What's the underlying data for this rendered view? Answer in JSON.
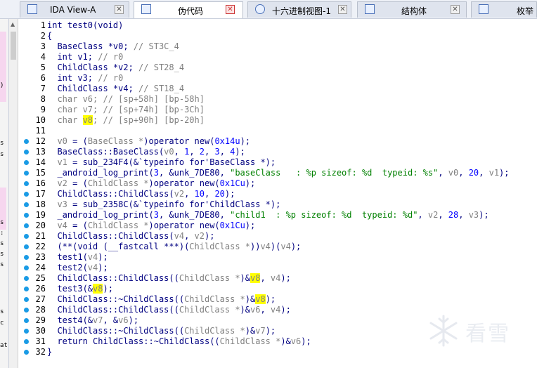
{
  "tabs": [
    {
      "label": "IDA View-A",
      "icon": "ida-view-icon",
      "active": false
    },
    {
      "label": "伪代码",
      "icon": "pseudocode-icon",
      "active": true
    },
    {
      "label": "十六进制视图-1",
      "icon": "hex-view-icon",
      "active": false
    },
    {
      "label": "结构体",
      "icon": "structures-icon",
      "active": false
    },
    {
      "label": "枚举",
      "icon": "enums-icon",
      "active": false
    }
  ],
  "left_fragments": [
    ")",
    "s",
    "s",
    "s",
    ":",
    "s",
    "s",
    "s",
    "s",
    "c",
    "at"
  ],
  "watermark": {
    "text": "看雪"
  },
  "colors": {
    "highlight": "#ffff00",
    "keyword": "#000080",
    "comment": "#808080",
    "string": "#008000",
    "number": "#0000ff",
    "breakpoint_dot": "#1a9be5"
  },
  "lines": [
    {
      "n": "1",
      "dot": false,
      "segs": [
        [
          "t",
          "int test0(void)"
        ]
      ]
    },
    {
      "n": "2",
      "dot": false,
      "segs": [
        [
          "t",
          "{"
        ]
      ]
    },
    {
      "n": "3",
      "dot": false,
      "segs": [
        [
          "t",
          "  BaseClass *v0; "
        ],
        [
          "c",
          "// ST3C_4"
        ]
      ]
    },
    {
      "n": "4",
      "dot": false,
      "segs": [
        [
          "t",
          "  int v1; "
        ],
        [
          "c",
          "// r0"
        ]
      ]
    },
    {
      "n": "5",
      "dot": false,
      "segs": [
        [
          "t",
          "  ChildClass *v2; "
        ],
        [
          "c",
          "// ST28_4"
        ]
      ]
    },
    {
      "n": "6",
      "dot": false,
      "segs": [
        [
          "t",
          "  int v3; "
        ],
        [
          "c",
          "// r0"
        ]
      ]
    },
    {
      "n": "7",
      "dot": false,
      "segs": [
        [
          "t",
          "  ChildClass *v4; "
        ],
        [
          "c",
          "// ST18_4"
        ]
      ]
    },
    {
      "n": "8",
      "dot": false,
      "segs": [
        [
          "c",
          "  char v6; // [sp+58h] [bp-58h]"
        ]
      ]
    },
    {
      "n": "9",
      "dot": false,
      "segs": [
        [
          "c",
          "  char v7; // [sp+74h] [bp-3Ch]"
        ]
      ]
    },
    {
      "n": "10",
      "dot": false,
      "segs": [
        [
          "c",
          "  char "
        ],
        [
          "ch",
          "v8"
        ],
        [
          "c",
          "; // [sp+90h] [bp-20h]"
        ]
      ]
    },
    {
      "n": "11",
      "dot": false,
      "segs": [
        [
          "t",
          ""
        ]
      ]
    },
    {
      "n": "12",
      "dot": true,
      "segs": [
        [
          "t",
          "  "
        ],
        [
          "g",
          "v0"
        ],
        [
          "t",
          " = ("
        ],
        [
          "g",
          "BaseClass *"
        ],
        [
          "t",
          ")operator new("
        ],
        [
          "n",
          "0x14u"
        ],
        [
          "t",
          ");"
        ]
      ]
    },
    {
      "n": "13",
      "dot": true,
      "segs": [
        [
          "t",
          "  BaseClass::BaseClass("
        ],
        [
          "g",
          "v0"
        ],
        [
          "t",
          ", "
        ],
        [
          "n",
          "1"
        ],
        [
          "t",
          ", "
        ],
        [
          "n",
          "2"
        ],
        [
          "t",
          ", "
        ],
        [
          "n",
          "3"
        ],
        [
          "t",
          ", "
        ],
        [
          "n",
          "4"
        ],
        [
          "t",
          ");"
        ]
      ]
    },
    {
      "n": "14",
      "dot": true,
      "segs": [
        [
          "t",
          "  "
        ],
        [
          "g",
          "v1"
        ],
        [
          "t",
          " = sub_234F4(&`typeinfo for'BaseClass *);"
        ]
      ]
    },
    {
      "n": "15",
      "dot": true,
      "segs": [
        [
          "t",
          "  _android_log_print("
        ],
        [
          "n",
          "3"
        ],
        [
          "t",
          ", &unk_7DE80, "
        ],
        [
          "s",
          "\"baseClass   : %p sizeof: %d  typeid: %s\""
        ],
        [
          "t",
          ", "
        ],
        [
          "g",
          "v0"
        ],
        [
          "t",
          ", "
        ],
        [
          "n",
          "20"
        ],
        [
          "t",
          ", "
        ],
        [
          "g",
          "v1"
        ],
        [
          "t",
          ");"
        ]
      ]
    },
    {
      "n": "16",
      "dot": true,
      "segs": [
        [
          "t",
          "  "
        ],
        [
          "g",
          "v2"
        ],
        [
          "t",
          " = ("
        ],
        [
          "g",
          "ChildClass *"
        ],
        [
          "t",
          ")operator new("
        ],
        [
          "n",
          "0x1Cu"
        ],
        [
          "t",
          ");"
        ]
      ]
    },
    {
      "n": "17",
      "dot": true,
      "segs": [
        [
          "t",
          "  ChildClass::ChildClass("
        ],
        [
          "g",
          "v2"
        ],
        [
          "t",
          ", "
        ],
        [
          "n",
          "10"
        ],
        [
          "t",
          ", "
        ],
        [
          "n",
          "20"
        ],
        [
          "t",
          ");"
        ]
      ]
    },
    {
      "n": "18",
      "dot": true,
      "segs": [
        [
          "t",
          "  "
        ],
        [
          "g",
          "v3"
        ],
        [
          "t",
          " = sub_2358C(&`typeinfo for'ChildClass *);"
        ]
      ]
    },
    {
      "n": "19",
      "dot": true,
      "segs": [
        [
          "t",
          "  _android_log_print("
        ],
        [
          "n",
          "3"
        ],
        [
          "t",
          ", &unk_7DE80, "
        ],
        [
          "s",
          "\"child1  : %p sizeof: %d  typeid: %d\""
        ],
        [
          "t",
          ", "
        ],
        [
          "g",
          "v2"
        ],
        [
          "t",
          ", "
        ],
        [
          "n",
          "28"
        ],
        [
          "t",
          ", "
        ],
        [
          "g",
          "v3"
        ],
        [
          "t",
          ");"
        ]
      ]
    },
    {
      "n": "20",
      "dot": true,
      "segs": [
        [
          "t",
          "  "
        ],
        [
          "g",
          "v4"
        ],
        [
          "t",
          " = ("
        ],
        [
          "g",
          "ChildClass *"
        ],
        [
          "t",
          ")operator new("
        ],
        [
          "n",
          "0x1Cu"
        ],
        [
          "t",
          ");"
        ]
      ]
    },
    {
      "n": "21",
      "dot": true,
      "segs": [
        [
          "t",
          "  ChildClass::ChildClass("
        ],
        [
          "g",
          "v4"
        ],
        [
          "t",
          ", "
        ],
        [
          "g",
          "v2"
        ],
        [
          "t",
          ");"
        ]
      ]
    },
    {
      "n": "22",
      "dot": true,
      "segs": [
        [
          "t",
          "  (**(void (__fastcall ***)("
        ],
        [
          "g",
          "ChildClass *"
        ],
        [
          "t",
          "))"
        ],
        [
          "g",
          "v4"
        ],
        [
          "t",
          ")("
        ],
        [
          "g",
          "v4"
        ],
        [
          "t",
          ");"
        ]
      ]
    },
    {
      "n": "23",
      "dot": true,
      "segs": [
        [
          "t",
          "  test1("
        ],
        [
          "g",
          "v4"
        ],
        [
          "t",
          ");"
        ]
      ]
    },
    {
      "n": "24",
      "dot": true,
      "segs": [
        [
          "t",
          "  test2("
        ],
        [
          "g",
          "v4"
        ],
        [
          "t",
          ");"
        ]
      ]
    },
    {
      "n": "25",
      "dot": true,
      "segs": [
        [
          "t",
          "  ChildClass::ChildClass(("
        ],
        [
          "g",
          "ChildClass *"
        ],
        [
          "t",
          ")&"
        ],
        [
          "gh",
          "v8"
        ],
        [
          "t",
          ", "
        ],
        [
          "g",
          "v4"
        ],
        [
          "t",
          ");"
        ]
      ]
    },
    {
      "n": "26",
      "dot": true,
      "segs": [
        [
          "t",
          "  test3(&"
        ],
        [
          "gh",
          "v8"
        ],
        [
          "t",
          ");"
        ]
      ]
    },
    {
      "n": "27",
      "dot": true,
      "segs": [
        [
          "t",
          "  ChildClass::~ChildClass(("
        ],
        [
          "g",
          "ChildClass *"
        ],
        [
          "t",
          ")&"
        ],
        [
          "gh",
          "v8"
        ],
        [
          "t",
          ");"
        ]
      ]
    },
    {
      "n": "28",
      "dot": true,
      "segs": [
        [
          "t",
          "  ChildClass::ChildClass(("
        ],
        [
          "g",
          "ChildClass *"
        ],
        [
          "t",
          ")&"
        ],
        [
          "g",
          "v6"
        ],
        [
          "t",
          ", "
        ],
        [
          "g",
          "v4"
        ],
        [
          "t",
          ");"
        ]
      ]
    },
    {
      "n": "29",
      "dot": true,
      "segs": [
        [
          "t",
          "  test4(&"
        ],
        [
          "g",
          "v7"
        ],
        [
          "t",
          ", &"
        ],
        [
          "g",
          "v6"
        ],
        [
          "t",
          ");"
        ]
      ]
    },
    {
      "n": "30",
      "dot": true,
      "segs": [
        [
          "t",
          "  ChildClass::~ChildClass(("
        ],
        [
          "g",
          "ChildClass *"
        ],
        [
          "t",
          ")&"
        ],
        [
          "g",
          "v7"
        ],
        [
          "t",
          ");"
        ]
      ]
    },
    {
      "n": "31",
      "dot": true,
      "segs": [
        [
          "t",
          "  return ChildClass::~ChildClass(("
        ],
        [
          "g",
          "ChildClass *"
        ],
        [
          "t",
          ")&"
        ],
        [
          "g",
          "v6"
        ],
        [
          "t",
          ");"
        ]
      ]
    },
    {
      "n": "32",
      "dot": true,
      "segs": [
        [
          "t",
          "}"
        ]
      ]
    }
  ]
}
